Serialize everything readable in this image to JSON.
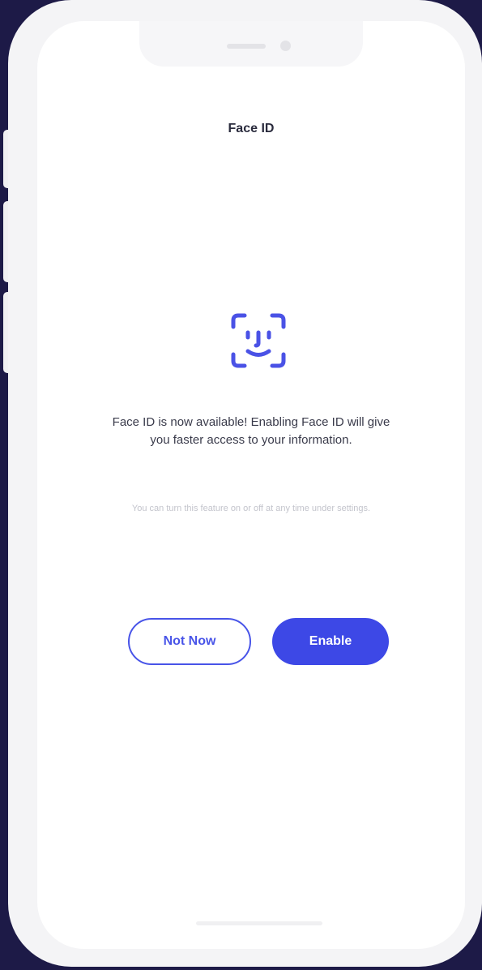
{
  "screen": {
    "title": "Face ID",
    "message": "Face ID is now available! Enabling Face ID will give you faster access to your information.",
    "hint": "You can turn this feature on or off at any time under settings."
  },
  "actions": {
    "not_now_label": "Not Now",
    "enable_label": "Enable"
  },
  "icons": {
    "face": "face-id-icon"
  },
  "colors": {
    "background": "#1d1a47",
    "accent": "#3d48e6",
    "title_text": "#2a2b3d",
    "hint_text": "#c3c4cc"
  }
}
